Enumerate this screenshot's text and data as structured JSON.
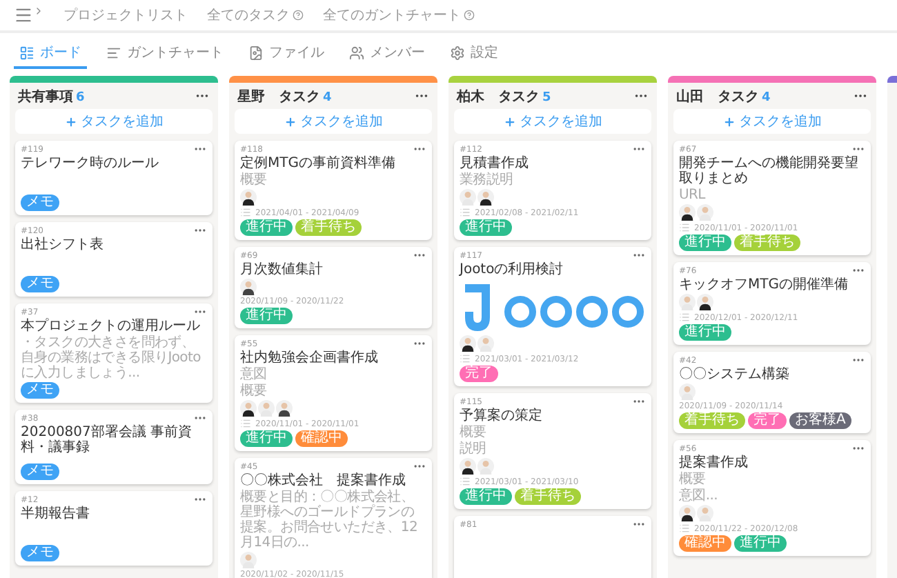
{
  "nav": [
    {
      "label": "プロジェクトリスト",
      "help": false
    },
    {
      "label": "全てのタスク",
      "help": true
    },
    {
      "label": "全てのガントチャート",
      "help": true
    }
  ],
  "tabs": [
    {
      "label": "ボード",
      "kind": "board",
      "selected": true
    },
    {
      "label": "ガントチャート",
      "kind": "gantt",
      "selected": false
    },
    {
      "label": "ファイル",
      "kind": "file",
      "selected": false
    },
    {
      "label": "メンバー",
      "kind": "member",
      "selected": false
    },
    {
      "label": "設定",
      "kind": "settings",
      "selected": false
    }
  ],
  "columns": [
    {
      "title": "共有事項",
      "count": "6",
      "color": "#2dbe8f",
      "add": "タスクを追加",
      "cards": [
        {
          "id": "#119",
          "title": "テレワーク時のルール",
          "tags": [
            {
              "label": "メモ",
              "color": "#3fa3f5"
            }
          ]
        },
        {
          "id": "#120",
          "title": "出社シフト表",
          "tags": [
            {
              "label": "メモ",
              "color": "#3fa3f5"
            }
          ]
        },
        {
          "id": "#37",
          "title": "本プロジェクトの運用ルール",
          "lines": [
            "・タスクの大きさを問わず、自身の業務はできる限りJootoに入力しましょう..."
          ],
          "tags": [
            {
              "label": "メモ",
              "color": "#3fa3f5"
            }
          ]
        },
        {
          "id": "#38",
          "title": "20200807部署会議 事前資料・議事録",
          "tags": [
            {
              "label": "メモ",
              "color": "#3fa3f5"
            }
          ]
        },
        {
          "id": "#12",
          "title": "半期報告書",
          "tags": [
            {
              "label": "メモ",
              "color": "#3fa3f5"
            }
          ]
        }
      ]
    },
    {
      "title": "星野　タスク",
      "count": "4",
      "color": "#ff9147",
      "add": "タスクを追加",
      "cards": [
        {
          "id": "#118",
          "title": "定例MTGの事前資料準備",
          "lines": [
            "概要"
          ],
          "avatars": [
            {
              "kind": "dark"
            }
          ],
          "list_icon": true,
          "dates": "2021/04/01 - 2021/04/09",
          "tags": [
            {
              "label": "進行中",
              "color": "#2dbe8f"
            },
            {
              "label": "着手待ち",
              "color": "#a5d13a"
            }
          ]
        },
        {
          "id": "#69",
          "title": "月次数値集計",
          "avatars": [
            {
              "kind": "suit"
            }
          ],
          "list_icon": false,
          "dates": "2020/11/09 - 2020/11/22",
          "tags": [
            {
              "label": "進行中",
              "color": "#2dbe8f"
            }
          ]
        },
        {
          "id": "#55",
          "title": "社内勉強会企画書作成",
          "lines": [
            "意図",
            "概要"
          ],
          "avatars": [
            {
              "kind": "dark"
            },
            {
              "kind": "light"
            },
            {
              "kind": "suit"
            }
          ],
          "list_icon": true,
          "dates": "2020/11/01 - 2020/11/01",
          "tags": [
            {
              "label": "進行中",
              "color": "#2dbe8f"
            },
            {
              "label": "確認中",
              "color": "#ff8c3a"
            }
          ]
        },
        {
          "id": "#45",
          "title": "〇〇株式会社　提案書作成",
          "lines": [
            "概要と目的：〇〇株式会社、星野様へのゴールドプランの提案。お問合せいただき、12月14日の..."
          ],
          "avatars": [
            {
              "kind": "light"
            }
          ],
          "list_icon": false,
          "dates": "2020/11/02 - 2020/11/15"
        }
      ]
    },
    {
      "title": "柏木　タスク",
      "count": "5",
      "color": "#a8d23f",
      "add": "タスクを追加",
      "cards": [
        {
          "id": "#112",
          "title": "見積書作成",
          "lines": [
            "業務説明"
          ],
          "avatars": [
            {
              "kind": "light"
            },
            {
              "kind": "dark"
            }
          ],
          "list_icon": true,
          "dates": "2021/02/08 - 2021/02/11",
          "tags": [
            {
              "label": "進行中",
              "color": "#2dbe8f"
            }
          ]
        },
        {
          "id": "#117",
          "title": "Jootoの利用検討",
          "attachment": {
            "kind": "picture"
          },
          "avatars": [
            {
              "kind": "dark"
            },
            {
              "kind": "light"
            }
          ],
          "list_icon": true,
          "dates": "2021/03/01 - 2021/03/12",
          "tags": [
            {
              "label": "完了",
              "color": "#ff6eb4"
            }
          ]
        },
        {
          "id": "#115",
          "title": "予算案の策定",
          "lines": [
            "概要",
            "説明"
          ],
          "avatars": [
            {
              "kind": "dark"
            },
            {
              "kind": "light"
            }
          ],
          "list_icon": true,
          "dates": "2021/03/01 - 2021/03/10",
          "tags": [
            {
              "label": "進行中",
              "color": "#2dbe8f"
            },
            {
              "label": "着手待ち",
              "color": "#a5d13a"
            }
          ]
        },
        {
          "id": "#81"
        }
      ]
    },
    {
      "title": "山田　タスク",
      "count": "4",
      "color": "#f571b5",
      "add": "タスクを追加",
      "cards": [
        {
          "id": "#67",
          "title": "開発チームへの機能開発要望取りまとめ",
          "lines": [
            "URL"
          ],
          "avatars": [
            {
              "kind": "dark"
            },
            {
              "kind": "light"
            }
          ],
          "list_icon": true,
          "dates": "2020/11/01 - 2020/11/01",
          "tags": [
            {
              "label": "進行中",
              "color": "#2dbe8f"
            },
            {
              "label": "着手待ち",
              "color": "#a5d13a"
            }
          ]
        },
        {
          "id": "#76",
          "title": "キックオフMTGの開催準備",
          "avatars": [
            {
              "kind": "light"
            },
            {
              "kind": "dark"
            }
          ],
          "list_icon": true,
          "dates": "2020/12/01 - 2020/12/11",
          "tags": [
            {
              "label": "進行中",
              "color": "#2dbe8f"
            }
          ]
        },
        {
          "id": "#42",
          "title": "〇〇システム構築",
          "avatars": [
            {
              "kind": "light"
            }
          ],
          "list_icon": false,
          "dates": "2020/11/09 - 2020/11/14",
          "tags": [
            {
              "label": "着手待ち",
              "color": "#a5d13a"
            },
            {
              "label": "完了",
              "color": "#ff6eb4"
            },
            {
              "label": "お客様A",
              "color": "#6b6b78"
            }
          ]
        },
        {
          "id": "#56",
          "title": "提案書作成",
          "lines": [
            "概要",
            "意図..."
          ],
          "avatars": [
            {
              "kind": "dark"
            },
            {
              "kind": "light"
            }
          ],
          "list_icon": true,
          "dates": "2020/11/22 - 2020/12/08",
          "tags": [
            {
              "label": "確認中",
              "color": "#ff8c3a"
            },
            {
              "label": "進行中",
              "color": "#2dbe8f"
            }
          ]
        }
      ]
    }
  ],
  "partial_column": {
    "color": "#7a6fd8"
  }
}
